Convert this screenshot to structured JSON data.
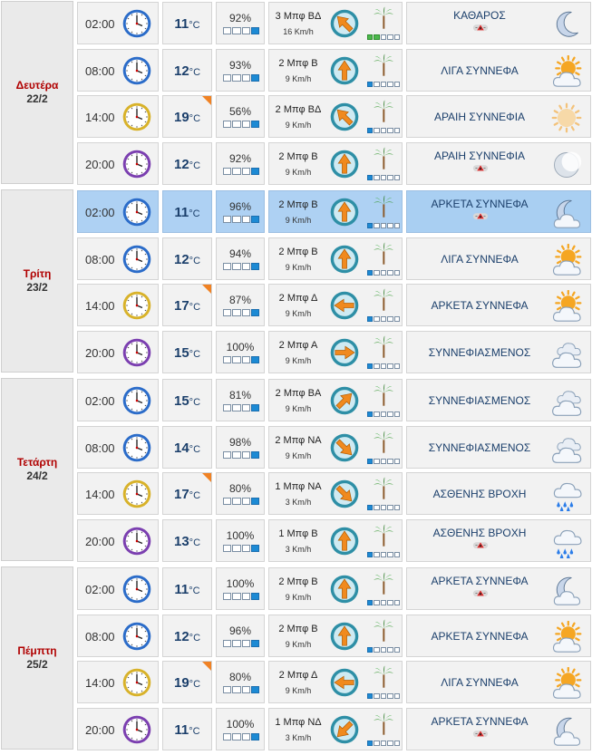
{
  "temp_unit": "°C",
  "days": [
    {
      "name": "Δευτέρα",
      "date": "22/2",
      "rows": [
        {
          "time": "02:00",
          "clock": "blue",
          "temp": "11",
          "warm": false,
          "hum": "92%",
          "hum_level": 4,
          "bf": "3 Μπφ ΒΔ",
          "speed": "16 Km/h",
          "dir_deg": 135,
          "wind_level": 2,
          "wind_color": "green",
          "cond": "ΚΑΘΑΡΟΣ",
          "icon": "moon-icon",
          "mosquito": true,
          "hl": false
        },
        {
          "time": "08:00",
          "clock": "blue",
          "temp": "12",
          "warm": false,
          "hum": "93%",
          "hum_level": 4,
          "bf": "2 Μπφ Β",
          "speed": "9 Km/h",
          "dir_deg": 180,
          "wind_level": 1,
          "wind_color": "blue",
          "cond": "ΛΙΓΑ ΣΥΝΝΕΦΑ",
          "icon": "sun-cloud-icon",
          "mosquito": false,
          "hl": false
        },
        {
          "time": "14:00",
          "clock": "gold",
          "temp": "19",
          "warm": true,
          "hum": "56%",
          "hum_level": 2,
          "bf": "2 Μπφ ΒΔ",
          "speed": "9 Km/h",
          "dir_deg": 135,
          "wind_level": 1,
          "wind_color": "blue",
          "cond": "ΑΡΑΙΗ ΣΥΝΝΕΦΙΑ",
          "icon": "hazy-sun-icon",
          "mosquito": false,
          "hl": false
        },
        {
          "time": "20:00",
          "clock": "purple",
          "temp": "12",
          "warm": false,
          "hum": "92%",
          "hum_level": 4,
          "bf": "2 Μπφ Β",
          "speed": "9 Km/h",
          "dir_deg": 180,
          "wind_level": 1,
          "wind_color": "blue",
          "cond": "ΑΡΑΙΗ ΣΥΝΝΕΦΙΑ",
          "icon": "hazy-moon-icon",
          "mosquito": true,
          "hl": false
        }
      ]
    },
    {
      "name": "Τρίτη",
      "date": "23/2",
      "rows": [
        {
          "time": "02:00",
          "clock": "blue",
          "temp": "11",
          "warm": false,
          "hum": "96%",
          "hum_level": 4,
          "bf": "2 Μπφ Β",
          "speed": "9 Km/h",
          "dir_deg": 180,
          "wind_level": 1,
          "wind_color": "blue",
          "cond": "ΑΡΚΕΤΑ ΣΥΝΝΕΦΑ",
          "icon": "moon-cloud-icon",
          "mosquito": true,
          "hl": true
        },
        {
          "time": "08:00",
          "clock": "blue",
          "temp": "12",
          "warm": false,
          "hum": "94%",
          "hum_level": 4,
          "bf": "2 Μπφ Β",
          "speed": "9 Km/h",
          "dir_deg": 180,
          "wind_level": 1,
          "wind_color": "blue",
          "cond": "ΛΙΓΑ ΣΥΝΝΕΦΑ",
          "icon": "sun-cloud-icon",
          "mosquito": false,
          "hl": false
        },
        {
          "time": "14:00",
          "clock": "gold",
          "temp": "17",
          "warm": true,
          "hum": "87%",
          "hum_level": 4,
          "bf": "2 Μπφ Δ",
          "speed": "9 Km/h",
          "dir_deg": 90,
          "wind_level": 1,
          "wind_color": "blue",
          "cond": "ΑΡΚΕΤΑ ΣΥΝΝΕΦΑ",
          "icon": "sun-cloud-icon",
          "mosquito": false,
          "hl": false
        },
        {
          "time": "20:00",
          "clock": "purple",
          "temp": "15",
          "warm": false,
          "hum": "100%",
          "hum_level": 4,
          "bf": "2 Μπφ Α",
          "speed": "9 Km/h",
          "dir_deg": 270,
          "wind_level": 1,
          "wind_color": "blue",
          "cond": "ΣΥΝΝΕΦΙΑΣΜΕΝΟΣ",
          "icon": "cloud-icon",
          "mosquito": false,
          "hl": false
        }
      ]
    },
    {
      "name": "Τετάρτη",
      "date": "24/2",
      "rows": [
        {
          "time": "02:00",
          "clock": "blue",
          "temp": "15",
          "warm": false,
          "hum": "81%",
          "hum_level": 4,
          "bf": "2 Μπφ ΒΑ",
          "speed": "9 Km/h",
          "dir_deg": 225,
          "wind_level": 1,
          "wind_color": "blue",
          "cond": "ΣΥΝΝΕΦΙΑΣΜΕΝΟΣ",
          "icon": "cloud-icon",
          "mosquito": false,
          "hl": false
        },
        {
          "time": "08:00",
          "clock": "blue",
          "temp": "14",
          "warm": false,
          "hum": "98%",
          "hum_level": 4,
          "bf": "2 Μπφ ΝΑ",
          "speed": "9 Km/h",
          "dir_deg": 315,
          "wind_level": 1,
          "wind_color": "blue",
          "cond": "ΣΥΝΝΕΦΙΑΣΜΕΝΟΣ",
          "icon": "cloud-icon",
          "mosquito": false,
          "hl": false
        },
        {
          "time": "14:00",
          "clock": "gold",
          "temp": "17",
          "warm": true,
          "hum": "80%",
          "hum_level": 4,
          "bf": "1 Μπφ ΝΑ",
          "speed": "3 Km/h",
          "dir_deg": 315,
          "wind_level": 1,
          "wind_color": "blue",
          "cond": "ΑΣΘΕΝΗΣ ΒΡΟΧΗ",
          "icon": "rain-icon",
          "mosquito": false,
          "hl": false
        },
        {
          "time": "20:00",
          "clock": "purple",
          "temp": "13",
          "warm": false,
          "hum": "100%",
          "hum_level": 4,
          "bf": "1 Μπφ Β",
          "speed": "3 Km/h",
          "dir_deg": 180,
          "wind_level": 1,
          "wind_color": "blue",
          "cond": "ΑΣΘΕΝΗΣ ΒΡΟΧΗ",
          "icon": "rain-icon",
          "mosquito": true,
          "hl": false
        }
      ]
    },
    {
      "name": "Πέμπτη",
      "date": "25/2",
      "rows": [
        {
          "time": "02:00",
          "clock": "blue",
          "temp": "11",
          "warm": false,
          "hum": "100%",
          "hum_level": 4,
          "bf": "2 Μπφ Β",
          "speed": "9 Km/h",
          "dir_deg": 180,
          "wind_level": 1,
          "wind_color": "blue",
          "cond": "ΑΡΚΕΤΑ ΣΥΝΝΕΦΑ",
          "icon": "moon-cloud-icon",
          "mosquito": true,
          "hl": false
        },
        {
          "time": "08:00",
          "clock": "blue",
          "temp": "12",
          "warm": false,
          "hum": "96%",
          "hum_level": 4,
          "bf": "2 Μπφ Β",
          "speed": "9 Km/h",
          "dir_deg": 180,
          "wind_level": 1,
          "wind_color": "blue",
          "cond": "ΑΡΚΕΤΑ ΣΥΝΝΕΦΑ",
          "icon": "sun-cloud-icon",
          "mosquito": false,
          "hl": false
        },
        {
          "time": "14:00",
          "clock": "gold",
          "temp": "19",
          "warm": true,
          "hum": "80%",
          "hum_level": 4,
          "bf": "2 Μπφ Δ",
          "speed": "9 Km/h",
          "dir_deg": 90,
          "wind_level": 1,
          "wind_color": "blue",
          "cond": "ΛΙΓΑ ΣΥΝΝΕΦΑ",
          "icon": "sun-cloud-icon",
          "mosquito": false,
          "hl": false
        },
        {
          "time": "20:00",
          "clock": "purple",
          "temp": "11",
          "warm": false,
          "hum": "100%",
          "hum_level": 4,
          "bf": "1 Μπφ ΝΔ",
          "speed": "3 Km/h",
          "dir_deg": 45,
          "wind_level": 1,
          "wind_color": "blue",
          "cond": "ΑΡΚΕΤΑ ΣΥΝΝΕΦΑ",
          "icon": "moon-cloud-icon",
          "mosquito": true,
          "hl": false
        }
      ]
    }
  ]
}
